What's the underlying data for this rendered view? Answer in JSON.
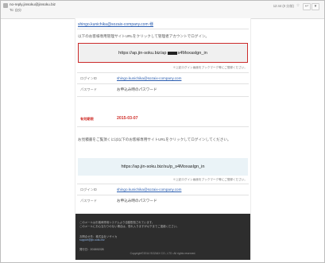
{
  "header": {
    "sender": "no-reply.jinsoku@jinsoku.biz",
    "recipient": "To: 自分",
    "date": "12:44 (0 分前)",
    "star_glyph": "☆",
    "reply_glyph": "↩",
    "more_glyph": "▾"
  },
  "email": {
    "to_address": "shingo.kunichika@sozaix-company.com 様",
    "intro": "以下のお客様専用管理サイトURLをクリックして管理者アカウントでログイン。",
    "login_url_prefix": "https://ap.jin-soku.biz/ap",
    "login_url_suffix": "s4Moxaslgn_in",
    "url_note": "※上記ログイン画面をブックマーク等にご登録ください。",
    "login_label": "ログインID",
    "login_value": "shingo.kunichika@sozaix-company.com",
    "password_label": "パスワード",
    "password_value": "お申込み時のパスワード",
    "expiry_label": "有効期限",
    "expiry_value": "2015-03-07",
    "intro2": "お見積書をご覧頂くには以下のお客様専用サイトURLをクリックしてログインしてください。",
    "quote_url": "https://ap.jin-soku.biz/su/p_s4Moxaslgn_in",
    "quote_note": "※上記ログイン画面をブックマーク等にご登録ください。",
    "login_label2": "ログインID",
    "login_value2": "shingo.kunichika@sozaix-company.com",
    "password_label2": "パスワード",
    "password_value2": "お申込み時のパスワード"
  },
  "footer": {
    "line1": "このメールはお客様専用システムより自動配信されています。",
    "line2": "このメールにお心当たりのない場合は、恐れ入りますが以下までご連絡ください。",
    "line3": "お問合せ先：株式会社ソザイカ",
    "line4": "support@jin-soku.biz",
    "line5": "発行日：2015/02/28",
    "copyright": "Copyright©2014 SOZAIX CO., LTD. All rights reserved."
  }
}
